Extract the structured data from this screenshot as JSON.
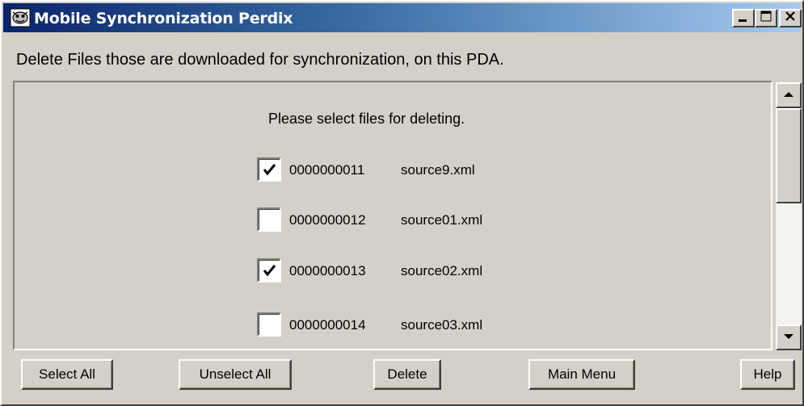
{
  "window": {
    "title": "Mobile Synchronization Perdix",
    "controls": {
      "minimize_icon": "minimize-icon",
      "maximize_icon": "maximize-icon",
      "close_icon": "close-icon"
    }
  },
  "header": {
    "description": "Delete Files those are downloaded for synchronization, on this PDA."
  },
  "main": {
    "prompt": "Please select files for deleting.",
    "files": [
      {
        "id": "0000000011",
        "name": "source9.xml",
        "checked": true
      },
      {
        "id": "0000000012",
        "name": "source01.xml",
        "checked": false
      },
      {
        "id": "0000000013",
        "name": "source02.xml",
        "checked": true
      },
      {
        "id": "0000000014",
        "name": "source03.xml",
        "checked": false
      }
    ]
  },
  "toolbar": {
    "select_all_label": "Select All",
    "unselect_all_label": "Unselect All",
    "delete_label": "Delete",
    "main_menu_label": "Main Menu",
    "help_label": "Help"
  },
  "colors": {
    "title_gradient_start": "#0a246a",
    "title_gradient_end": "#a6caf0",
    "face": "#d4d0c8"
  }
}
